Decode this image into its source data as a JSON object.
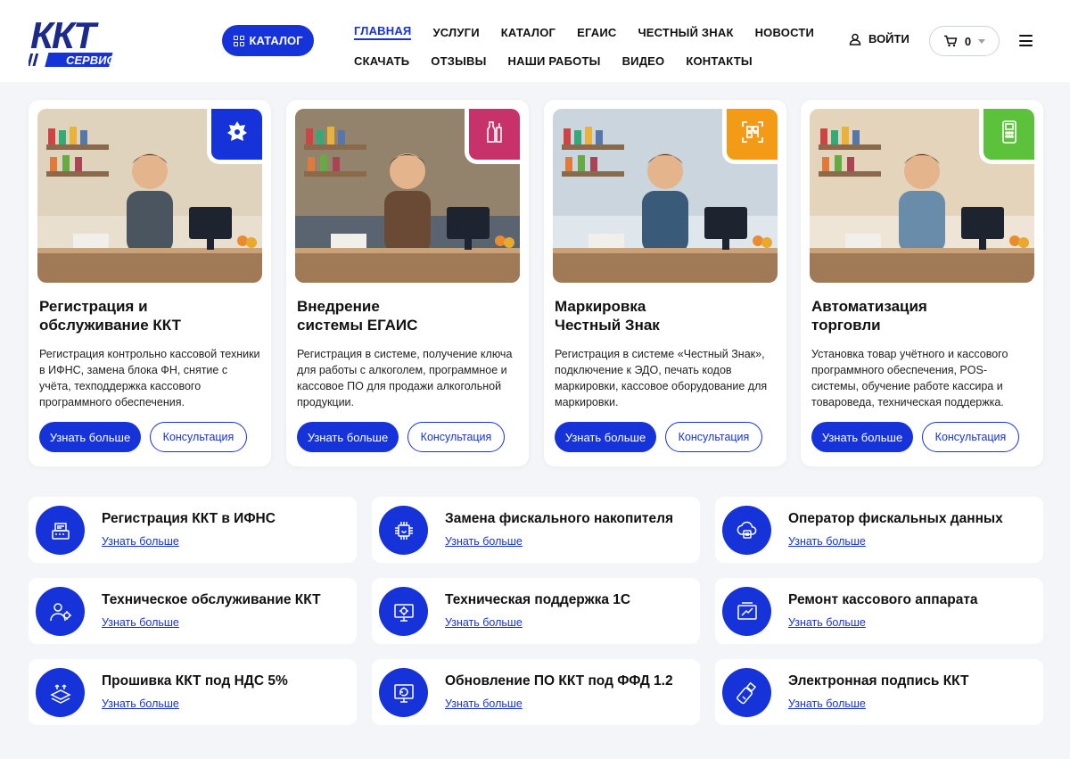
{
  "header": {
    "logo_main": "ККТ",
    "logo_sub": "СЕРВИС",
    "catalog_button": "КАТАЛОГ",
    "nav_row1": [
      "ГЛАВНАЯ",
      "УСЛУГИ",
      "КАТАЛОГ",
      "ЕГАИС",
      "ЧЕСТНЫЙ ЗНАК",
      "НОВОСТИ"
    ],
    "nav_row2": [
      "СКАЧАТЬ",
      "ОТЗЫВЫ",
      "НАШИ РАБОТЫ",
      "ВИДЕО",
      "КОНТАКТЫ"
    ],
    "active_nav": "ГЛАВНАЯ",
    "login_label": "ВОЙТИ",
    "cart_count": "0"
  },
  "cards": [
    {
      "title_line1": "Регистрация и",
      "title_line2": "обслуживание ККТ",
      "description": "Регистрация контрольно кассовой техники в ИФНС, замена блока ФН, снятие с учёта, техподдержка кассового программного обеспечения.",
      "primary": "Узнать больше",
      "secondary": "Консультация",
      "badge_color": "#1533d9",
      "badge_icon": "emblem-icon"
    },
    {
      "title_line1": "Внедрение",
      "title_line2": "системы ЕГАИС",
      "description": "Регистрация в системе, получение ключа для работы с алкоголем, программное и кассовое ПО для продажи алкогольной продукции.",
      "primary": "Узнать больше",
      "secondary": "Консультация",
      "badge_color": "#c8326a",
      "badge_icon": "bottles-icon"
    },
    {
      "title_line1": "Маркировка",
      "title_line2": "Честный Знак",
      "description": "Регистрация в системе «Честный Знак», подключение к ЭДО, печать кодов маркировки, кассовое оборудование для маркировки.",
      "primary": "Узнать больше",
      "secondary": "Консультация",
      "badge_color": "#f39a16",
      "badge_icon": "qr-code-icon"
    },
    {
      "title_line1": "Автоматизация",
      "title_line2": "торговли",
      "description": "Установка товар учётного и кассового программного обеспечения, POS-системы, обучение работе кассира и товароведа, техническая поддержка.",
      "primary": "Узнать больше",
      "secondary": "Консультация",
      "badge_color": "#5cc23b",
      "badge_icon": "pos-terminal-icon"
    }
  ],
  "services": [
    {
      "title": "Регистрация ККТ в ИФНС",
      "link": "Узнать больше",
      "icon": "cash-register-icon"
    },
    {
      "title": "Замена фискального накопителя",
      "link": "Узнать больше",
      "icon": "chip-icon"
    },
    {
      "title": "Оператор фискальных данных",
      "link": "Узнать больше",
      "icon": "cloud-icon"
    },
    {
      "title": "Техническое обслуживание ККТ",
      "link": "Узнать больше",
      "icon": "technician-icon"
    },
    {
      "title": "Техническая поддержка 1С",
      "link": "Узнать больше",
      "icon": "settings-screen-icon"
    },
    {
      "title": "Ремонт кассового аппарата",
      "link": "Узнать больше",
      "icon": "repair-icon"
    },
    {
      "title": "Прошивка ККТ под НДС 5%",
      "link": "Узнать больше",
      "icon": "layers-upload-icon"
    },
    {
      "title": "Обновление ПО ККТ под ФФД 1.2",
      "link": "Узнать больше",
      "icon": "monitor-update-icon"
    },
    {
      "title": "Электронная подпись ККТ",
      "link": "Узнать больше",
      "icon": "usb-token-icon"
    }
  ]
}
